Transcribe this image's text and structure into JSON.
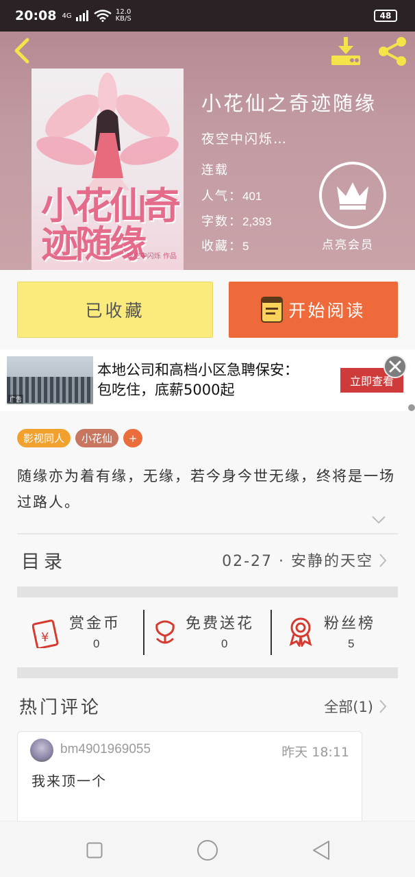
{
  "status_bar": {
    "time": "20:08",
    "signal": "4G",
    "speed_value": "12.0",
    "speed_unit": "KB/S",
    "battery": "48"
  },
  "book": {
    "title": "小花仙之奇迹随缘",
    "author": "夜空中闪烁…",
    "status": "连载",
    "popularity_label": "人气：",
    "popularity": "401",
    "words_label": "字数：",
    "words": "2,393",
    "favorites_label": "收藏：",
    "favorites": "5",
    "cover_title": "小花仙奇迹随缘",
    "cover_author": "夜空中闪烁 作品"
  },
  "vip": {
    "label": "点亮会员"
  },
  "actions": {
    "favorite_label": "已收藏",
    "read_label": "开始阅读"
  },
  "ad": {
    "text_line1": "本地公司和高档小区急聘保安：",
    "text_line2": "包吃住，底薪5000起",
    "cta": "立即查看",
    "badge": "广告"
  },
  "tags": [
    "影视同人",
    "小花仙"
  ],
  "tag_add": "+",
  "intro": "随缘亦为着有缘，无缘，若今身今世无缘，终将是一场过路人。",
  "toc": {
    "label": "目录",
    "latest": "02-27 · 安静的天空"
  },
  "interactions": [
    {
      "label": "赏金币",
      "value": "0",
      "icon": "red-envelope-icon"
    },
    {
      "label": "免费送花",
      "value": "0",
      "icon": "flower-icon"
    },
    {
      "label": "粉丝榜",
      "value": "5",
      "icon": "medal-icon"
    }
  ],
  "comments": {
    "label": "热门评论",
    "all": "全部(1)",
    "items": [
      {
        "user": "bm4901969055",
        "time": "昨天 18:11",
        "body": "我来顶一个"
      }
    ]
  },
  "colors": {
    "accent_orange": "#ee6a3a",
    "fav_yellow": "#faeb7c",
    "icon_red": "#d63a2f"
  }
}
